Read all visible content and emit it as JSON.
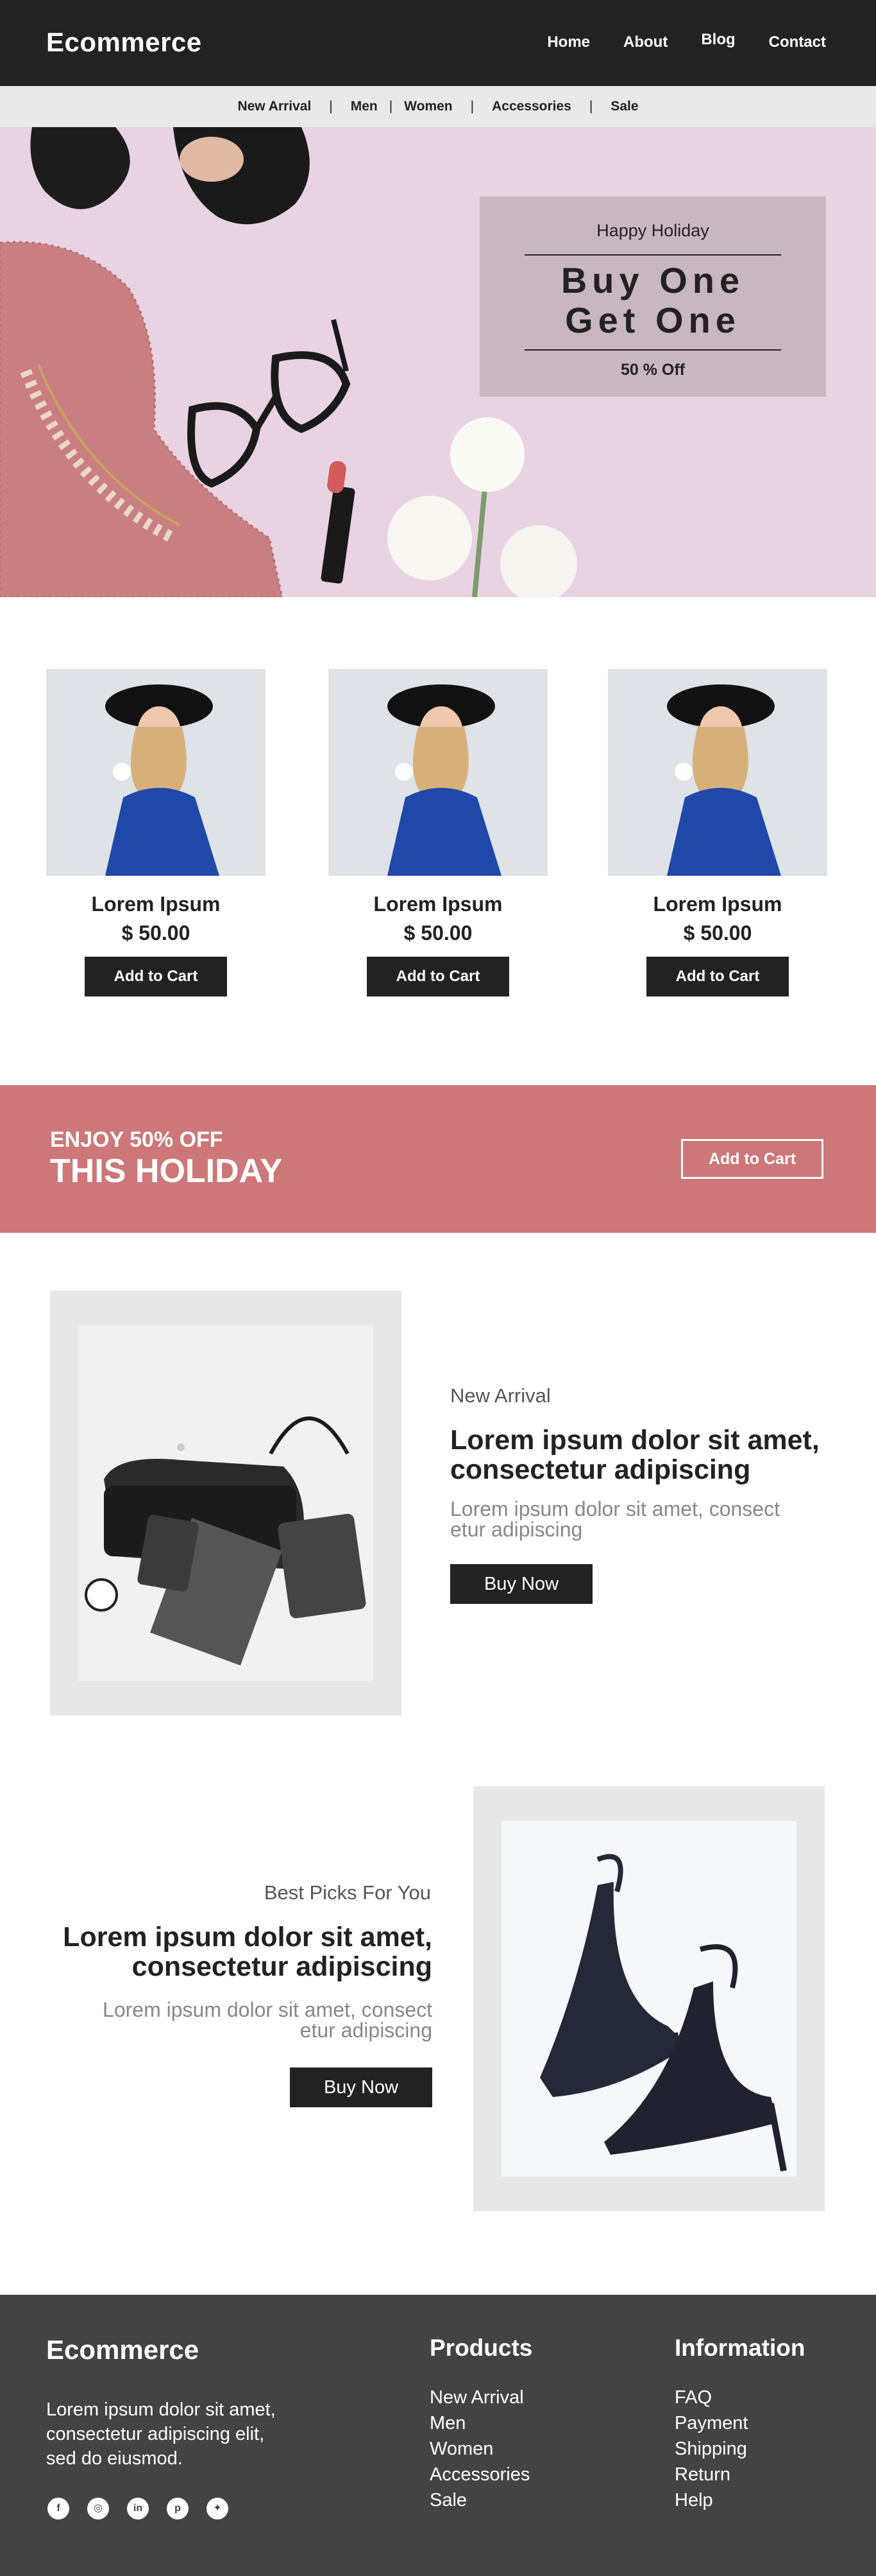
{
  "header": {
    "logo": "Ecommerce",
    "nav": [
      "Home",
      "About",
      "Blog",
      "Contact"
    ]
  },
  "subnav": {
    "items": [
      "New Arrival",
      "Men",
      "Women",
      "Accessories",
      "Sale"
    ],
    "separator": "|"
  },
  "hero": {
    "promo_top": "Happy Holiday",
    "promo_line1": "Buy One",
    "promo_line2": "Get One",
    "promo_off": "50 % Off"
  },
  "products": [
    {
      "name": "Lorem Ipsum",
      "price": "$ 50.00",
      "button": "Add to Cart"
    },
    {
      "name": "Lorem Ipsum",
      "price": "$ 50.00",
      "button": "Add to Cart"
    },
    {
      "name": "Lorem Ipsum",
      "price": "$ 50.00",
      "button": "Add to Cart"
    }
  ],
  "banner": {
    "small": "ENJOY 50% OFF",
    "big": "THIS HOLIDAY",
    "button": "Add to Cart",
    "color": "#cd7779"
  },
  "feature1": {
    "eyebrow": "New Arrival",
    "headline_l1": "Lorem ipsum dolor sit amet,",
    "headline_l2": "consectetur adipiscing",
    "desc_l1": "Lorem ipsum dolor sit amet, consect",
    "desc_l2": "etur adipiscing",
    "button": "Buy Now"
  },
  "feature2": {
    "eyebrow": "Best Picks For You",
    "headline_l1": "Lorem ipsum dolor sit amet,",
    "headline_l2": "consectetur adipiscing",
    "desc_l1": "Lorem ipsum dolor sit amet, consect",
    "desc_l2": "etur adipiscing",
    "button": "Buy Now"
  },
  "footer": {
    "logo": "Ecommerce",
    "about_l1": "Lorem ipsum dolor sit amet,",
    "about_l2": "consectetur adipiscing elit,",
    "about_l3": "sed do eiusmod.",
    "social_icons": [
      "facebook-icon",
      "instagram-icon",
      "linkedin-icon",
      "pinterest-icon",
      "twitter-icon"
    ],
    "products_title": "Products",
    "products_links": [
      "New Arrival",
      "Men",
      "Women",
      "Accessories",
      "Sale"
    ],
    "info_title": "Information",
    "info_links": [
      "FAQ",
      "Payment",
      "Shipping",
      "Return",
      "Help"
    ]
  }
}
